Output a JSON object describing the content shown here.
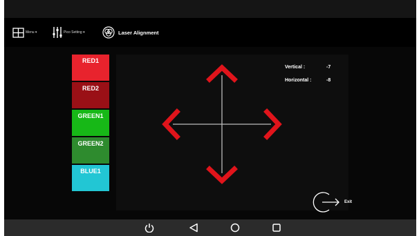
{
  "toolbar": {
    "menu_label": "Menu ▾",
    "pico_label": "Pico Setting ▾",
    "title": "Laser Alignment",
    "icons": [
      "grid-icon",
      "sliders-icon",
      "rgb-circles-icon"
    ]
  },
  "color_buttons": [
    {
      "label": "RED1",
      "color": "#e8232d"
    },
    {
      "label": "RED2",
      "color": "#9a1016"
    },
    {
      "label": "GREEN1",
      "color": "#17b817"
    },
    {
      "label": "GREEN2",
      "color": "#2e8b2e"
    },
    {
      "label": "BLUE1",
      "color": "#22c6d4"
    }
  ],
  "readouts": {
    "vertical_label": "Vertical :",
    "vertical_value": "-7",
    "horizontal_label": "Horizontal :",
    "horizontal_value": "-8"
  },
  "arrows": {
    "color": "#e0141b",
    "crosshair_color": "#bdbdbd",
    "icons": [
      "arrow-up-icon",
      "arrow-down-icon",
      "arrow-left-icon",
      "arrow-right-icon"
    ]
  },
  "exit": {
    "label": "Exit",
    "icon": "exit-icon"
  },
  "navbar": {
    "icons": [
      "power-icon",
      "back-icon",
      "home-icon",
      "recents-icon"
    ]
  }
}
